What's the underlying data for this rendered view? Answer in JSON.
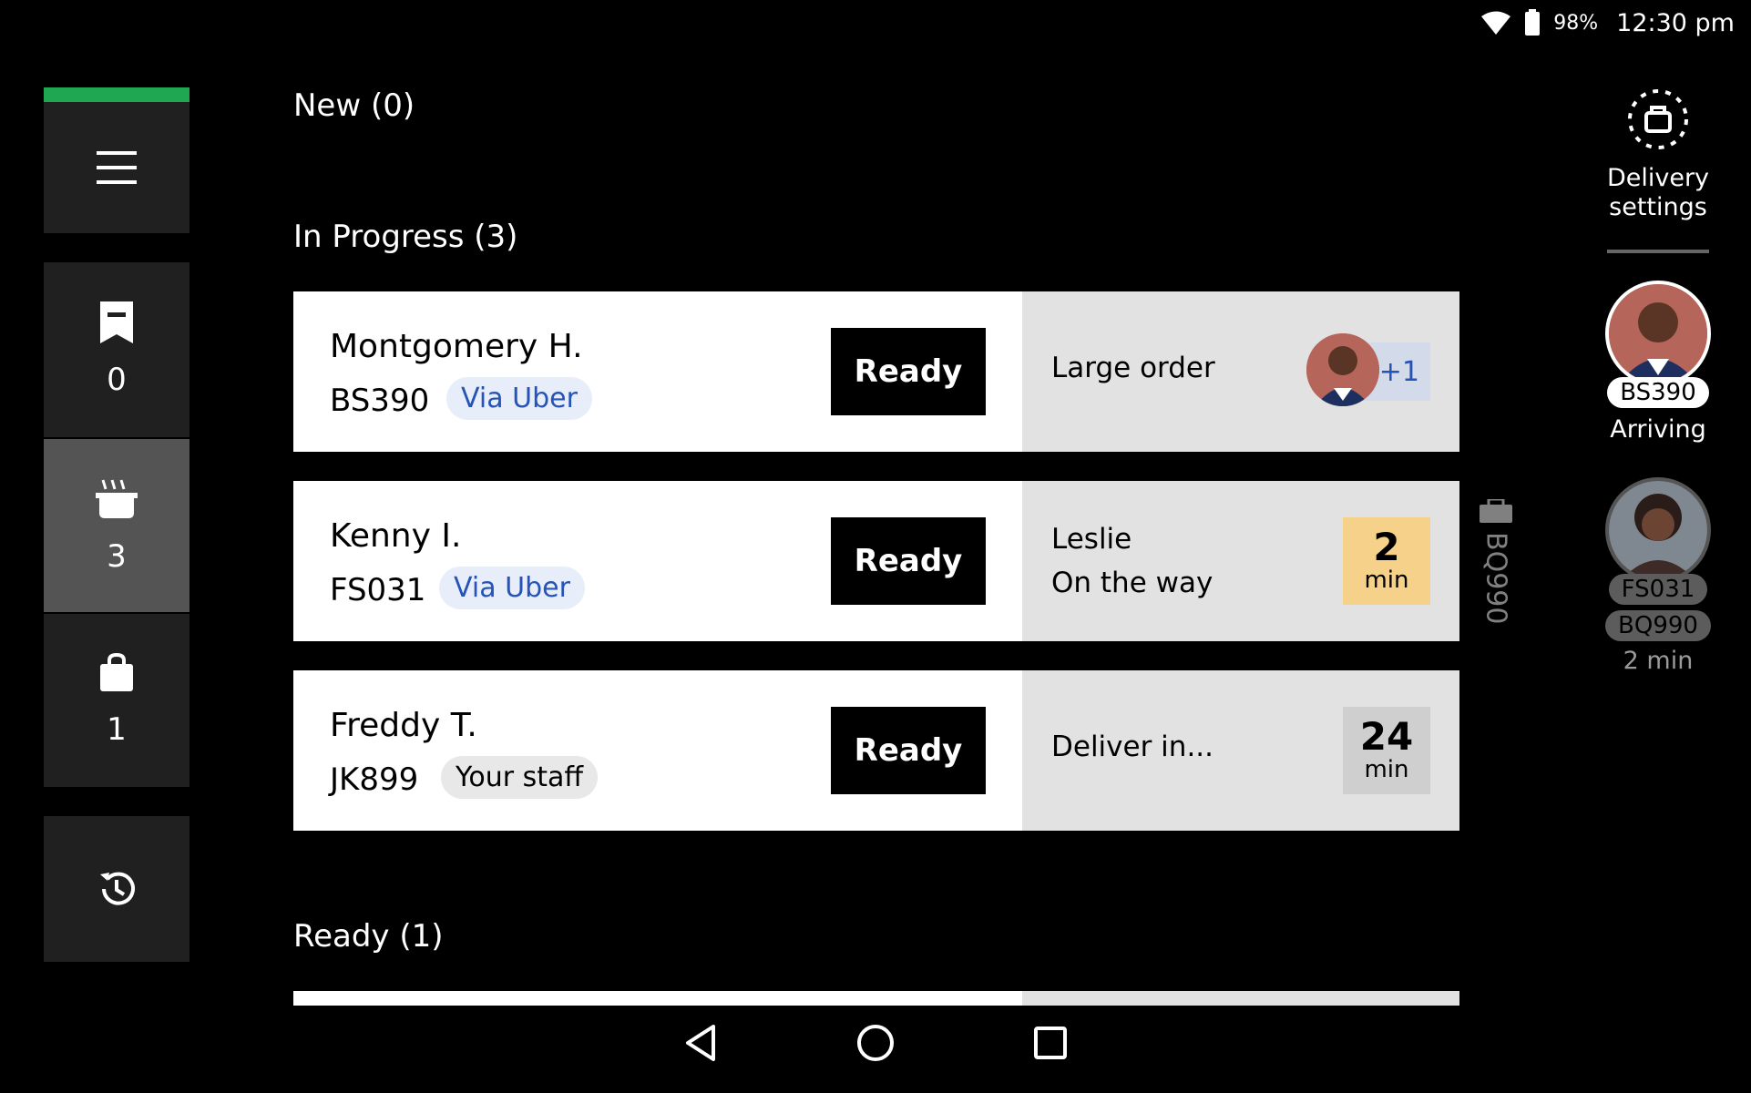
{
  "status_bar": {
    "battery": "98%",
    "time": "12:30 pm"
  },
  "left_nav": {
    "accent_color": "#1fa851",
    "tiles": [
      {
        "icon": "receipt-icon",
        "count": "0"
      },
      {
        "icon": "cooking-pot-icon",
        "count": "3"
      },
      {
        "icon": "bag-icon",
        "count": "1"
      }
    ]
  },
  "sections": {
    "new": "New (0)",
    "in_progress": "In Progress (3)",
    "ready": "Ready (1)"
  },
  "orders": [
    {
      "name": "Montgomery H.",
      "id": "BS390",
      "tag": "Via Uber",
      "button": "Ready",
      "status": "Large order",
      "extra": "+1"
    },
    {
      "name": "Kenny I.",
      "id": "FS031",
      "tag": "Via Uber",
      "button": "Ready",
      "courier": "Leslie",
      "status": "On the way",
      "minutes": "2",
      "unit": "min"
    },
    {
      "name": "Freddy T.",
      "id": "JK899",
      "tag": "Your staff",
      "button": "Ready",
      "status": "Deliver in...",
      "minutes": "24",
      "unit": "min"
    }
  ],
  "vertical_tag": "BQ990",
  "right_panel": {
    "settings_label": "Delivery settings",
    "driver1": {
      "chip": "BS390",
      "status": "Arriving"
    },
    "driver2": {
      "chips": [
        "FS031",
        "BQ990"
      ],
      "eta": "2 min"
    }
  }
}
